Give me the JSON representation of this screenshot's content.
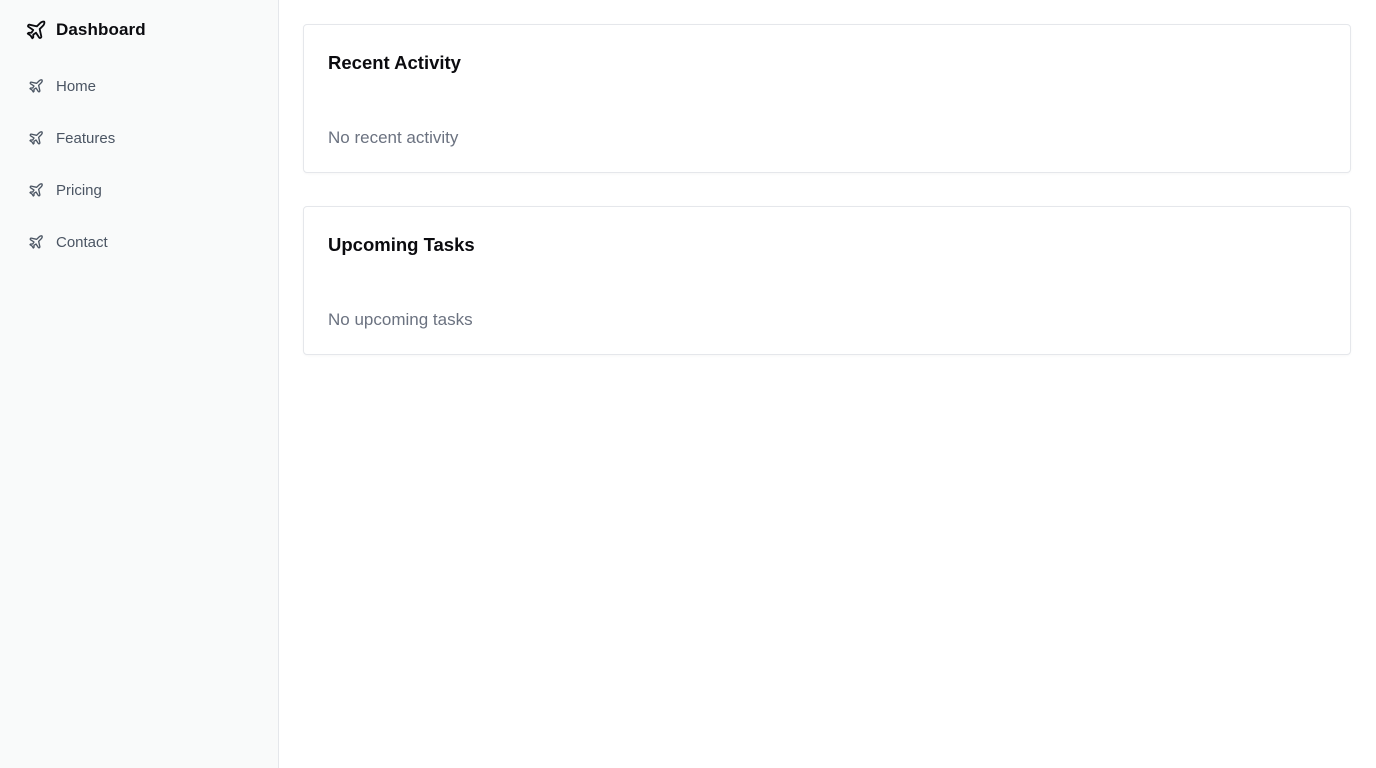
{
  "sidebar": {
    "brand": {
      "label": "Dashboard",
      "icon": "plane-icon"
    },
    "items": [
      {
        "label": "Home",
        "icon": "plane-icon"
      },
      {
        "label": "Features",
        "icon": "plane-icon"
      },
      {
        "label": "Pricing",
        "icon": "plane-icon"
      },
      {
        "label": "Contact",
        "icon": "plane-icon"
      }
    ]
  },
  "main": {
    "cards": [
      {
        "title": "Recent Activity",
        "body": "No recent activity"
      },
      {
        "title": "Upcoming Tasks",
        "body": "No upcoming tasks"
      }
    ]
  },
  "colors": {
    "sidebar_bg": "#f9fafa",
    "border": "#e5e7eb",
    "text_primary": "#0b0b0f",
    "text_nav": "#4b5563",
    "text_muted": "#6b7280"
  }
}
